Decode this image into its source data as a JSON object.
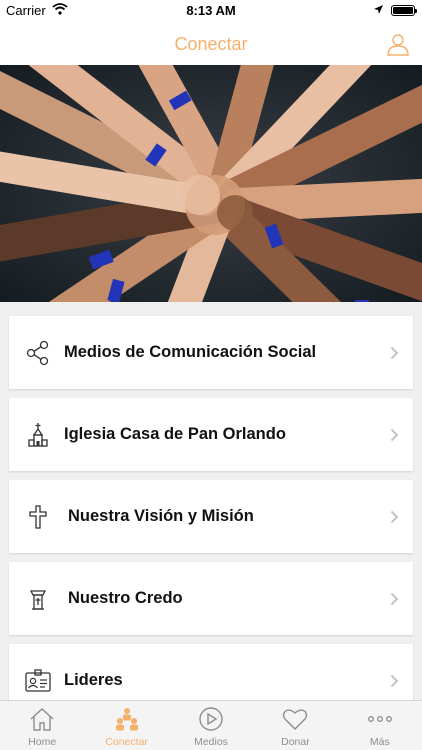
{
  "status_bar": {
    "carrier": "Carrier",
    "time": "8:13 AM"
  },
  "nav": {
    "title": "Conectar",
    "profile_icon": "person-icon"
  },
  "hero": {
    "icon": "hands-together-photo"
  },
  "menu": {
    "items": [
      {
        "label": "Medios de Comunicación Social",
        "icon": "share-icon"
      },
      {
        "label": "Iglesia Casa de Pan Orlando",
        "icon": "church-icon"
      },
      {
        "label": "Nuestra Visión y Misión",
        "icon": "cross-icon"
      },
      {
        "label": "Nuestro Credo",
        "icon": "pulpit-icon"
      },
      {
        "label": "Lideres",
        "icon": "id-card-icon"
      }
    ]
  },
  "tabs": [
    {
      "label": "Home",
      "icon": "house-icon",
      "active": false
    },
    {
      "label": "Conectar",
      "icon": "people-icon",
      "active": true
    },
    {
      "label": "Medios",
      "icon": "play-icon",
      "active": false
    },
    {
      "label": "Donar",
      "icon": "heart-icon",
      "active": false
    },
    {
      "label": "Más",
      "icon": "more-icon",
      "active": false
    }
  ],
  "colors": {
    "accent": "#f5b06b",
    "inactive": "#8e8e8e",
    "background": "#f0f0f0"
  }
}
